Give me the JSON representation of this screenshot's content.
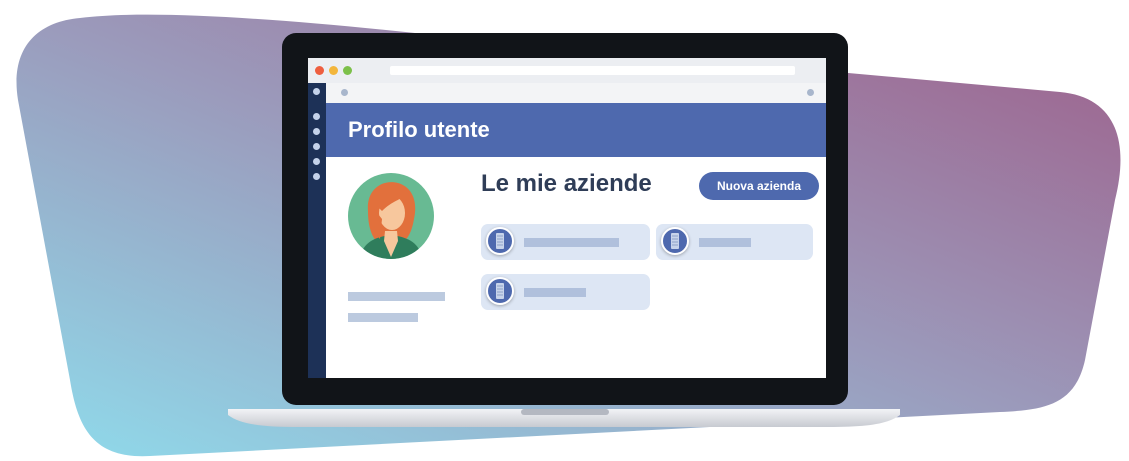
{
  "colors": {
    "accent": "#4e69ae",
    "sidebar": "#1d3157",
    "card_background": "#dde6f4",
    "avatar_background": "#68ba93",
    "hair": "#e2703c",
    "skin": "#f7c79d",
    "blob_gradient": [
      "#8fdcec",
      "#9b9bbc",
      "#9e5f8a"
    ]
  },
  "window": {
    "controls": [
      "close",
      "minimize",
      "maximize"
    ]
  },
  "header": {
    "title": "Profilo utente"
  },
  "profile": {
    "avatar_icon": "user-avatar-woman-icon"
  },
  "companies": {
    "title": "Le mie aziende",
    "new_button_label": "Nuova azienda",
    "item_icon": "building-icon",
    "items": 3
  }
}
